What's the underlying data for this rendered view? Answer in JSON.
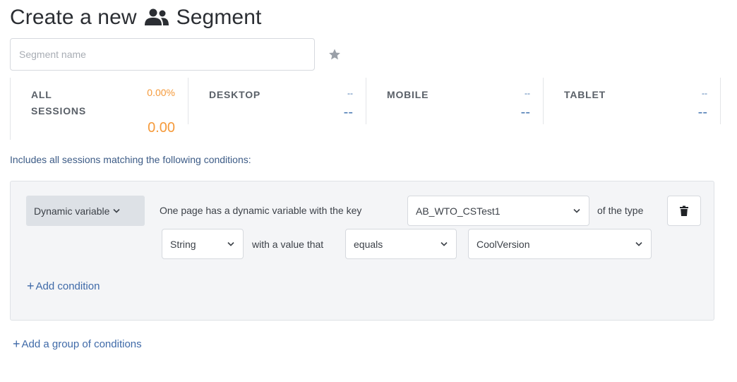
{
  "header": {
    "title_prefix": "Create a new",
    "title_suffix": "Segment",
    "icon": "people-icon"
  },
  "segment_name": {
    "placeholder": "Segment name",
    "value": ""
  },
  "favorite_icon": "star-icon",
  "stats": [
    {
      "label_line1": "ALL",
      "label_line2": "SESSIONS",
      "percent": "0.00%",
      "value": "0.00"
    },
    {
      "label_line1": "DESKTOP",
      "label_line2": "",
      "percent": "--",
      "value": "--"
    },
    {
      "label_line1": "MOBILE",
      "label_line2": "",
      "percent": "--",
      "value": "--"
    },
    {
      "label_line1": "TABLET",
      "label_line2": "",
      "percent": "--",
      "value": "--"
    }
  ],
  "includes_text": "Includes all sessions matching the following conditions:",
  "condition": {
    "type_button": "Dynamic variable",
    "text_before_key": "One page has a dynamic variable with the key",
    "key_value": "AB_WTO_CSTest1",
    "text_of_type": "of the type",
    "type_value": "String",
    "text_with_value": "with a value that",
    "operator_value": "equals",
    "value_value": "CoolVersion",
    "delete_icon": "trash-icon"
  },
  "add_condition_label": "Add condition",
  "add_group_label": "Add a group of conditions",
  "colors": {
    "accent_orange": "#f59a3b",
    "accent_blue": "#4a78b3",
    "link_blue": "#3f6aa8"
  }
}
